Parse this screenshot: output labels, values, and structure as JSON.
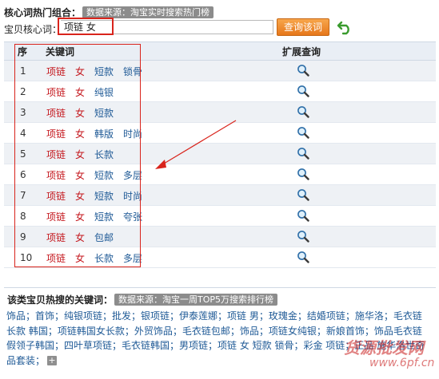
{
  "header": {
    "title": "核心词热门组合：",
    "source": "数据来源：淘宝实时搜索热门榜"
  },
  "keyword": {
    "label": "宝贝核心词：",
    "value": "项链 女",
    "button": "查询该词"
  },
  "table": {
    "col_num": "序",
    "col_kw": "关键词",
    "col_expand": "扩展查询",
    "rows": [
      {
        "n": "1",
        "words": [
          "项链",
          "女",
          "短款",
          "锁骨"
        ]
      },
      {
        "n": "2",
        "words": [
          "项链",
          "女",
          "纯银"
        ]
      },
      {
        "n": "3",
        "words": [
          "项链",
          "女",
          "短款"
        ]
      },
      {
        "n": "4",
        "words": [
          "项链",
          "女",
          "韩版",
          "时尚"
        ]
      },
      {
        "n": "5",
        "words": [
          "项链",
          "女",
          "长款"
        ]
      },
      {
        "n": "6",
        "words": [
          "项链",
          "女",
          "短款",
          "多层"
        ]
      },
      {
        "n": "7",
        "words": [
          "项链",
          "女",
          "短款",
          "时尚"
        ]
      },
      {
        "n": "8",
        "words": [
          "项链",
          "女",
          "短款",
          "夸张"
        ]
      },
      {
        "n": "9",
        "words": [
          "项链",
          "女",
          "包邮"
        ]
      },
      {
        "n": "10",
        "words": [
          "项链",
          "女",
          "长款",
          "多层"
        ]
      }
    ]
  },
  "hot_section": {
    "title": "该类宝贝热搜的关键词：",
    "source": "数据来源：淘宝一周TOP5万搜索排行榜",
    "lines": [
      "饰品；首饰；纯银项链；批发；银项链；伊泰莲娜；项链 男；玫瑰金；结婚项链；施华洛；毛衣链",
      "长款 韩国；项链韩国女长款；外贸饰品；毛衣链包邮；饰品；项链女纯银；新娘首饰；饰品毛衣链",
      "假领子韩国；四叶草项链；毛衣链韩国；男项链；项链 女 短款 锁骨；彩金 项链；正品 施华洛世奇",
      "品套装；"
    ]
  },
  "watermark": {
    "text": "货源批发网",
    "url": "www.6pf.cn"
  }
}
